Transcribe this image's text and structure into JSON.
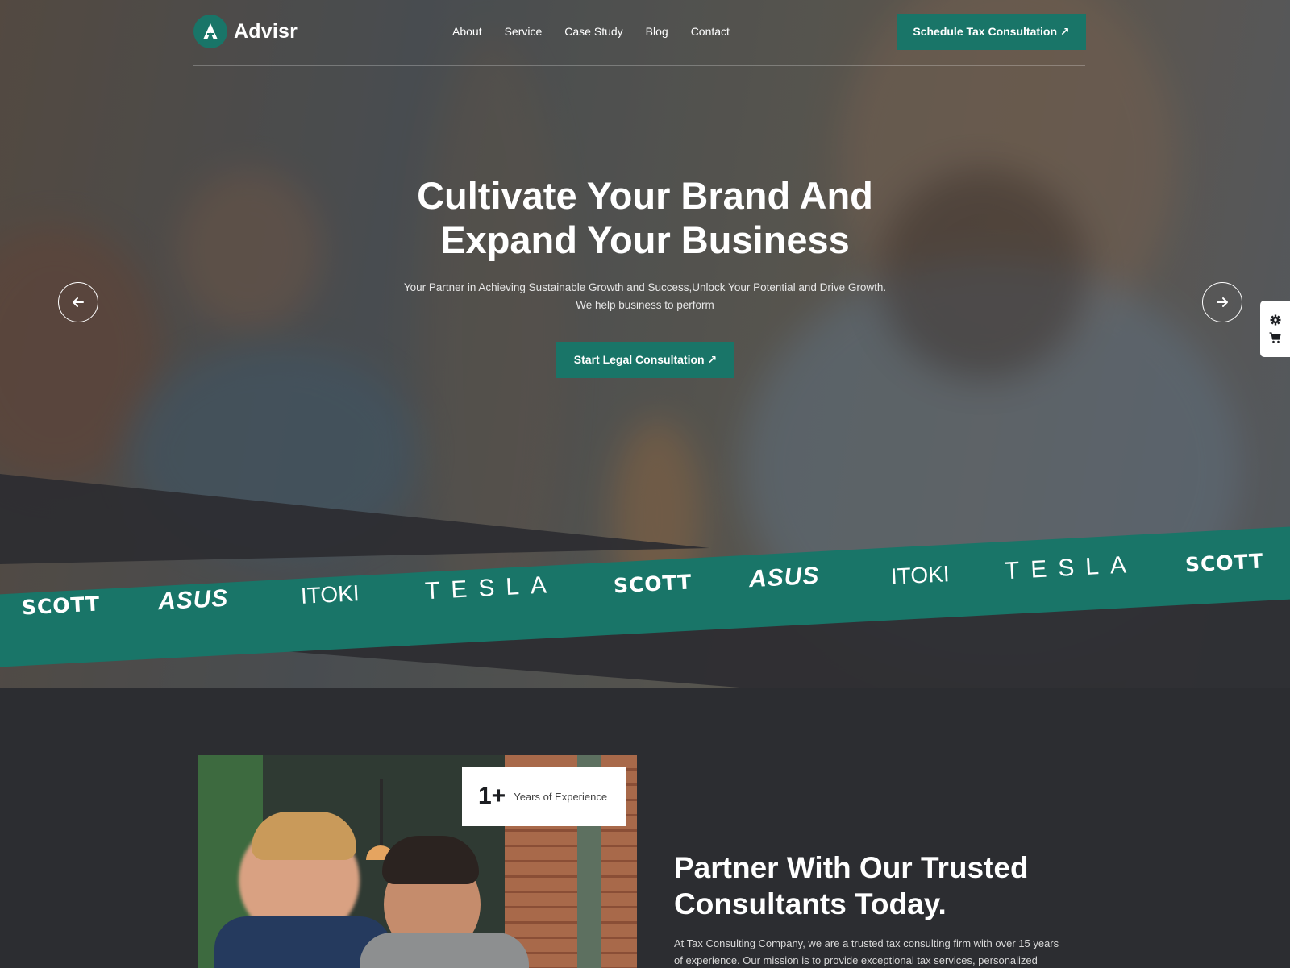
{
  "header": {
    "logo_text": "Advisr",
    "nav": [
      "About",
      "Service",
      "Case Study",
      "Blog",
      "Contact"
    ],
    "cta_label": "Schedule Tax Consultation ↗"
  },
  "hero": {
    "title_line1": "Cultivate Your Brand And",
    "title_line2": "Expand Your Business",
    "subtitle_line1": "Your Partner in Achieving Sustainable Growth and Success,Unlock Your Potential and Drive Growth.",
    "subtitle_line2": "We help business to perform",
    "cta_label": "Start Legal Consultation ↗",
    "prev_icon": "arrow-left-icon",
    "next_icon": "arrow-right-icon"
  },
  "side_panel": {
    "icons": [
      "gear-icon",
      "cart-icon"
    ]
  },
  "brands": [
    "SCOTT",
    "ASUS",
    "ITOKI",
    "TESLA",
    "SCOTT",
    "ASUS",
    "ITOKI",
    "TESLA",
    "SCOTT"
  ],
  "about": {
    "experience_number": "1+",
    "experience_label": "Years of Experience",
    "title_line1": "Partner With Our Trusted",
    "title_line2": "Consultants Today.",
    "text_line1": "At Tax Consulting Company, we are a trusted tax consulting firm with over 15 years",
    "text_line2": "of experience. Our mission is to provide exceptional tax services, personalized"
  },
  "colors": {
    "accent": "#197568",
    "dark": "#2c2d31"
  }
}
